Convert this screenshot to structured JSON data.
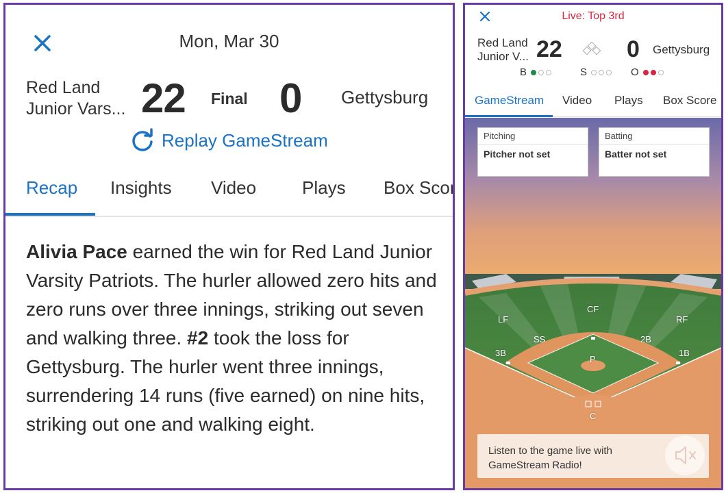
{
  "left": {
    "date": "Mon, Mar 30",
    "home_team": "Red Land Junior Vars...",
    "home_score": "22",
    "status": "Final",
    "away_score": "0",
    "away_team": "Gettysburg",
    "replay_label": "Replay GameStream",
    "tabs": [
      {
        "label": "Recap",
        "active": true
      },
      {
        "label": "Insights",
        "active": false
      },
      {
        "label": "Video",
        "active": false
      },
      {
        "label": "Plays",
        "active": false
      },
      {
        "label": "Box Score",
        "active": false
      }
    ],
    "recap": {
      "winner": "Alivia Pace",
      "part1": " earned the win for Red Land Junior Varsity Patriots. The hurler allowed zero hits and zero runs over three innings, striking out seven and walking three. ",
      "loser": "#2",
      "part2": " took the loss for Gettysburg. The hurler went three innings, surrendering 14 runs (five earned) on nine hits, striking out one and walking eight."
    }
  },
  "right": {
    "live_status": "Live: Top 3rd",
    "home_team": "Red Land Junior V...",
    "home_score": "22",
    "away_score": "0",
    "away_team": "Gettysburg",
    "count": {
      "balls_label": "B",
      "balls": 1,
      "strikes_label": "S",
      "strikes": 0,
      "outs_label": "O",
      "outs": 2
    },
    "tabs": [
      {
        "label": "GameStream",
        "active": true
      },
      {
        "label": "Video",
        "active": false
      },
      {
        "label": "Plays",
        "active": false
      },
      {
        "label": "Box Score",
        "active": false
      }
    ],
    "pitching": {
      "header": "Pitching",
      "value": "Pitcher not set"
    },
    "batting": {
      "header": "Batting",
      "value": "Batter not set"
    },
    "positions": [
      "CF",
      "LF",
      "RF",
      "SS",
      "2B",
      "3B",
      "1B",
      "P",
      "C"
    ],
    "radio_text": "Listen to the game live with GameStream Radio!"
  },
  "colors": {
    "accent": "#1a73c4",
    "border": "#6a3aa6",
    "live": "#d7263d",
    "ball_dot": "#1f8a4c",
    "out_dot": "#d7263d"
  }
}
